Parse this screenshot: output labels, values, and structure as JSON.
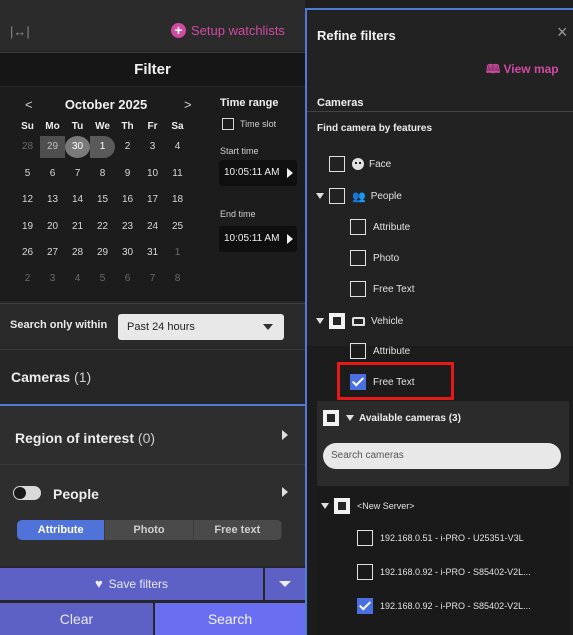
{
  "header": {
    "setup_watchlists": "Setup watchlists",
    "filter_title": "Filter"
  },
  "calendar": {
    "month": "October 2025",
    "prev": "<",
    "next": ">",
    "dow": [
      "Su",
      "Mo",
      "Tu",
      "We",
      "Th",
      "Fr",
      "Sa"
    ],
    "rows": [
      [
        "28",
        "29",
        "30",
        "1",
        "2",
        "3",
        "4"
      ],
      [
        "5",
        "6",
        "7",
        "8",
        "9",
        "10",
        "11"
      ],
      [
        "12",
        "13",
        "14",
        "15",
        "16",
        "17",
        "18"
      ],
      [
        "19",
        "20",
        "21",
        "22",
        "23",
        "24",
        "25"
      ],
      [
        "26",
        "27",
        "28",
        "29",
        "30",
        "31",
        "1"
      ],
      [
        "2",
        "3",
        "4",
        "5",
        "6",
        "7",
        "8"
      ]
    ]
  },
  "time_range": {
    "title": "Time range",
    "time_slot": "Time slot",
    "start_label": "Start time",
    "start_value": "10:05:11 AM",
    "end_label": "End time",
    "end_value": "10:05:11 AM"
  },
  "search_within": {
    "label": "Search only within",
    "value": "Past 24 hours"
  },
  "cameras": {
    "label": "Cameras",
    "count": "(1)"
  },
  "roi": {
    "label": "Region of interest",
    "count": "(0)"
  },
  "people": {
    "label": "People",
    "tabs": [
      "Attribute",
      "Photo",
      "Free text"
    ],
    "active_tab": "Attribute"
  },
  "actions": {
    "save_filters": "Save filters",
    "clear": "Clear",
    "search": "Search"
  },
  "refine": {
    "title": "Refine filters",
    "close": "×",
    "view_map": "View map",
    "cameras_label": "Cameras",
    "find_by_features": "Find camera by features",
    "options": {
      "face": "Face",
      "people": "People",
      "people_attribute": "Attribute",
      "people_photo": "Photo",
      "people_free_text": "Free Text",
      "vehicle": "Vehicle",
      "vehicle_attribute": "Attribute",
      "vehicle_free_text": "Free Text"
    },
    "available_cameras": "Available cameras (3)",
    "search_placeholder": "Search cameras",
    "server": "<New Server>",
    "camera_list": [
      {
        "name": "192.168.0.51 - i-PRO - U25351-V3L",
        "checked": false
      },
      {
        "name": "192.168.0.92 - i-PRO - S85402-V2L...",
        "checked": false
      },
      {
        "name": "192.168.0.92 - i-PRO - S85402-V2L...",
        "checked": true
      }
    ]
  },
  "colors": {
    "accent": "#4f7bd6",
    "watchlist": "#d14aa2",
    "button": "#5d61c6",
    "search_button": "#6a6ef0",
    "highlight": "#e61919"
  }
}
